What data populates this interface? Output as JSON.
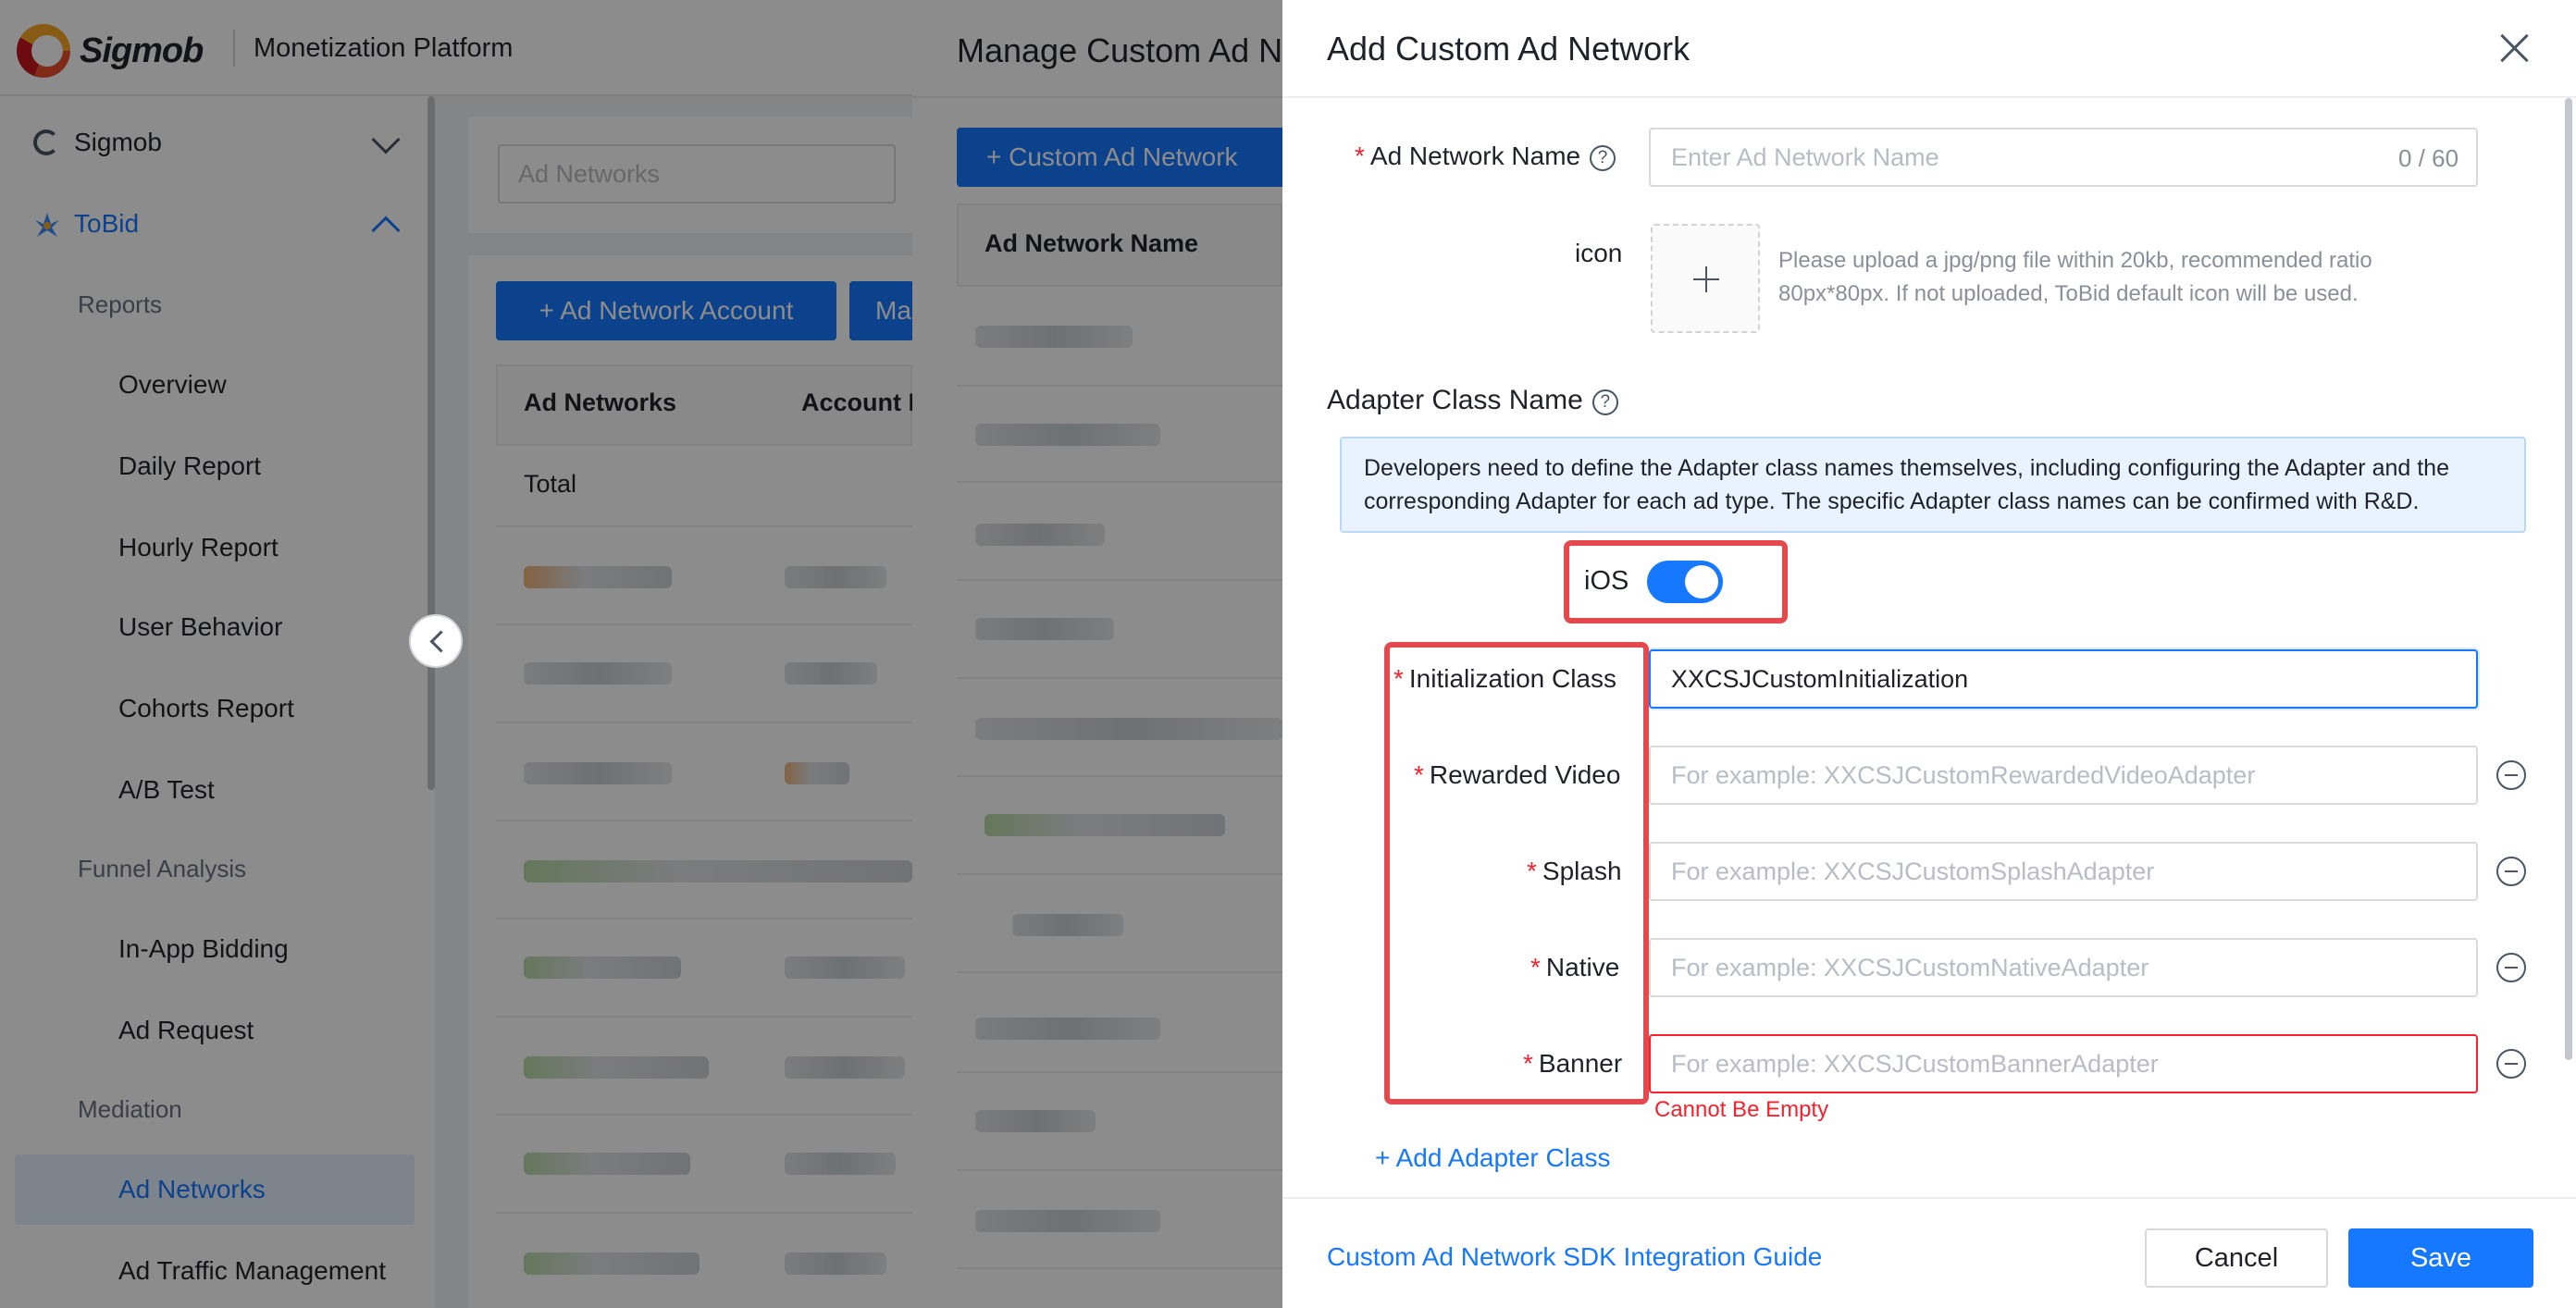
{
  "header": {
    "logo_text": "Sigmob",
    "platform_title": "Monetization Platform"
  },
  "sidebar": {
    "top_items": [
      {
        "label": "Sigmob"
      },
      {
        "label": "ToBid"
      }
    ],
    "groups": {
      "reports": "Reports",
      "funnel": "Funnel Analysis",
      "mediation": "Mediation"
    },
    "items": {
      "overview": "Overview",
      "daily": "Daily Report",
      "hourly": "Hourly Report",
      "behavior": "User Behavior",
      "cohorts": "Cohorts Report",
      "ab": "A/B Test",
      "bidding": "In-App Bidding",
      "adrequest": "Ad Request",
      "adnetworks": "Ad Networks",
      "traffic": "Ad Traffic Management"
    }
  },
  "main": {
    "search_placeholder": "Ad Networks",
    "add_account_button": "+ Ad Network Account",
    "second_button": "Ma",
    "table_headers": [
      "Ad Networks",
      "Account N"
    ],
    "total_label": "Total"
  },
  "mid_panel": {
    "title": "Manage Custom Ad N",
    "add_button": "+ Custom Ad Network",
    "column_header": "Ad Network Name"
  },
  "drawer": {
    "title": "Add Custom Ad Network",
    "name_label": "Ad Network Name",
    "name_placeholder": "Enter Ad Network Name",
    "name_counter": "0 / 60",
    "icon_label": "icon",
    "upload_hint": "Please upload a jpg/png file within 20kb, recommended ratio 80px*80px. If not uploaded, ToBid default icon will be used.",
    "section_title": "Adapter Class Name",
    "info_text": "Developers need to define the Adapter class names themselves, including configuring the Adapter and the corresponding Adapter for each ad type. The specific Adapter class names can be confirmed with R&D.",
    "ios_label": "iOS",
    "ios_enabled": true,
    "fields": {
      "init": {
        "label": "Initialization Class",
        "value": "XXCSJCustomInitialization"
      },
      "rewarded": {
        "label": "Rewarded Video",
        "placeholder": "For example: XXCSJCustomRewardedVideoAdapter"
      },
      "splash": {
        "label": "Splash",
        "placeholder": "For example: XXCSJCustomSplashAdapter"
      },
      "native": {
        "label": "Native",
        "placeholder": "For example: XXCSJCustomNativeAdapter"
      },
      "banner": {
        "label": "Banner",
        "placeholder": "For example: XXCSJCustomBannerAdapter"
      }
    },
    "required_mark": "*",
    "help_glyph": "?",
    "error_text": "Cannot Be Empty",
    "add_adapter": "+ Add Adapter Class",
    "guide_link": "Custom Ad Network SDK Integration Guide",
    "cancel": "Cancel",
    "save": "Save"
  },
  "colors": {
    "primary": "#1677ff",
    "error": "#f5222d",
    "highlight": "#e5484d"
  }
}
